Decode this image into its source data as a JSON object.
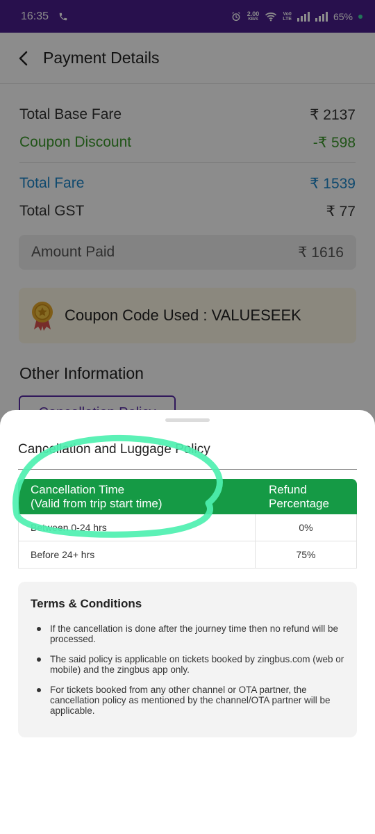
{
  "status_bar": {
    "time": "16:35",
    "net_speed_value": "2.00",
    "net_speed_unit": "KB/S",
    "volte_top": "Vo0",
    "volte_bottom": "LTE",
    "battery": "65%",
    "icons": [
      "phone-call-icon",
      "alarm-icon",
      "wifi-icon",
      "signal-icon",
      "signal-icon"
    ]
  },
  "header": {
    "title": "Payment Details"
  },
  "fare": {
    "base_fare_label": "Total Base Fare",
    "base_fare_value": "₹ 2137",
    "coupon_label": "Coupon Discount",
    "coupon_value": "-₹ 598",
    "total_fare_label": "Total Fare",
    "total_fare_value": "₹ 1539",
    "gst_label": "Total GST",
    "gst_value": "₹ 77",
    "amount_paid_label": "Amount Paid",
    "amount_paid_value": "₹ 1616"
  },
  "coupon": {
    "text": "Coupon Code Used : VALUESEEK"
  },
  "other_info": {
    "title": "Other Information",
    "cancellation_button": "Cancellation Policy"
  },
  "sheet": {
    "title": "Cancellation and Luggage Policy",
    "table": {
      "header_time_line1": "Cancellation Time",
      "header_time_line2": "(Valid from trip start time)",
      "header_refund_line1": "Refund",
      "header_refund_line2": "Percentage",
      "rows": [
        {
          "time": "Between 0-24 hrs",
          "refund": "0%"
        },
        {
          "time": "Before 24+ hrs",
          "refund": "75%"
        }
      ]
    },
    "terms": {
      "title": "Terms & Conditions",
      "items": [
        "If the cancellation is done after the journey time then no refund will be processed.",
        "The said policy is applicable on tickets booked by zingbus.com (web or mobile) and the zingbus app only.",
        "For tickets booked from any other channel or OTA partner, the cancellation policy as mentioned by the channel/OTA partner will be applicable."
      ]
    }
  },
  "colors": {
    "status_bar": "#4a1e8c",
    "coupon_green": "#3c9a2c",
    "total_blue": "#1d86c9",
    "table_header_green": "#159a45",
    "annotation": "#4ef0b0",
    "button_purple": "#5a2ea6"
  }
}
